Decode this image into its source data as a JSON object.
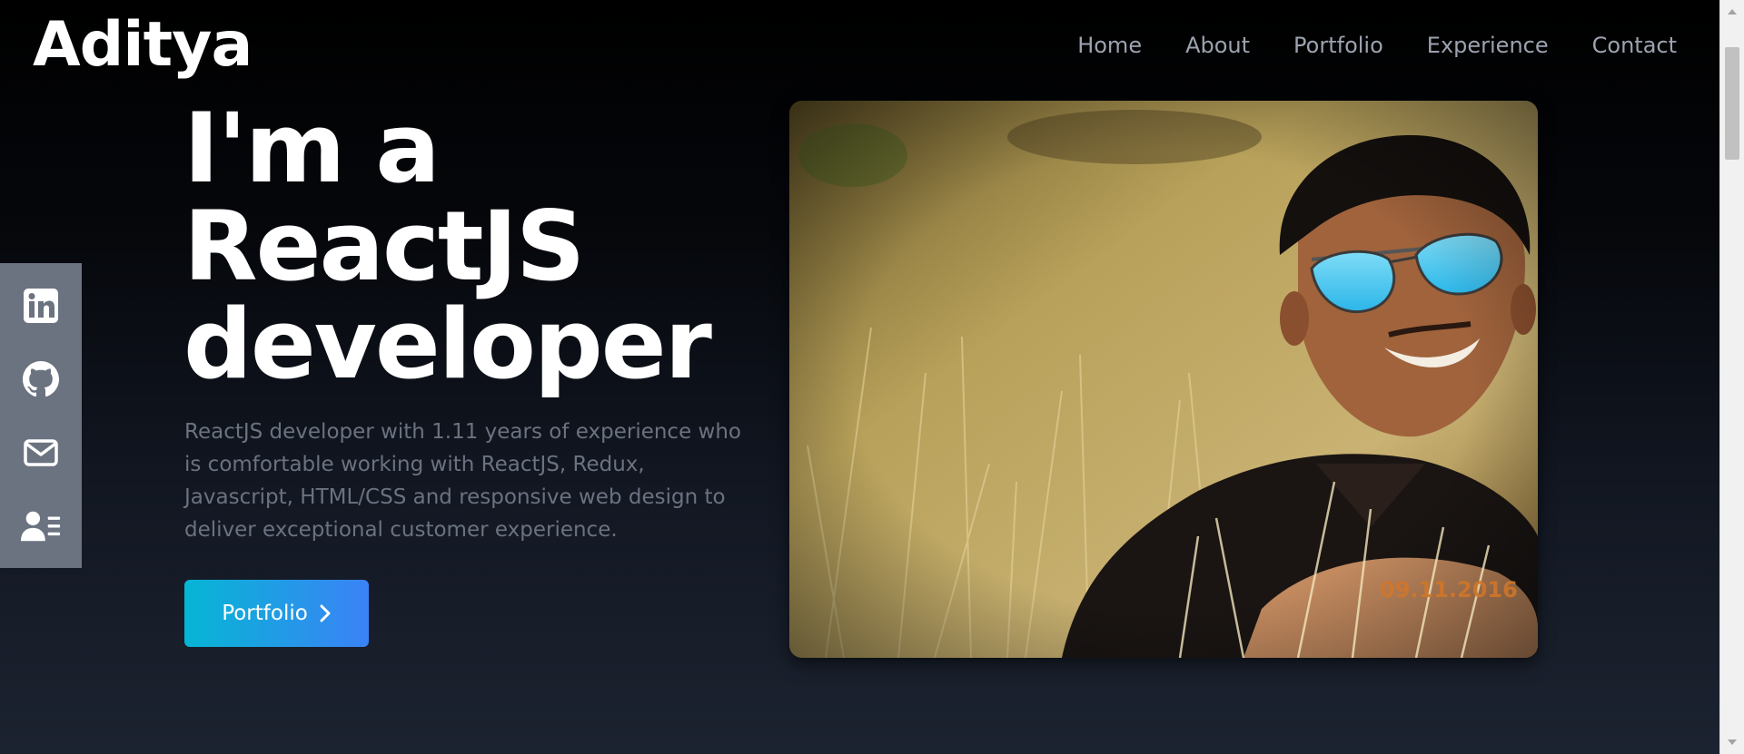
{
  "brand": {
    "name": "Aditya"
  },
  "nav": {
    "items": [
      {
        "label": "Home"
      },
      {
        "label": "About"
      },
      {
        "label": "Portfolio"
      },
      {
        "label": "Experience"
      },
      {
        "label": "Contact"
      }
    ]
  },
  "social": {
    "icons": [
      "linkedin-icon",
      "github-icon",
      "mail-icon",
      "resume-icon"
    ]
  },
  "hero": {
    "headline_line1": "I'm a",
    "headline_line2": "ReactJS",
    "headline_line3": "developer",
    "intro": "ReactJS developer with 1.11 years of experience who is comfortable working with ReactJS, Redux, Javascript, HTML/CSS and responsive web design to deliver exceptional customer experience.",
    "cta_label": "Portfolio",
    "cta_icon": "chevron-right-icon"
  },
  "photo": {
    "date_stamp": "09.11.2016"
  },
  "colors": {
    "nav_text": "#9ca3af",
    "sidebar_bg": "#6b7280",
    "cta_gradient_start": "#06b6d4",
    "cta_gradient_end": "#3b82f6",
    "intro_text": "#6b7280"
  }
}
